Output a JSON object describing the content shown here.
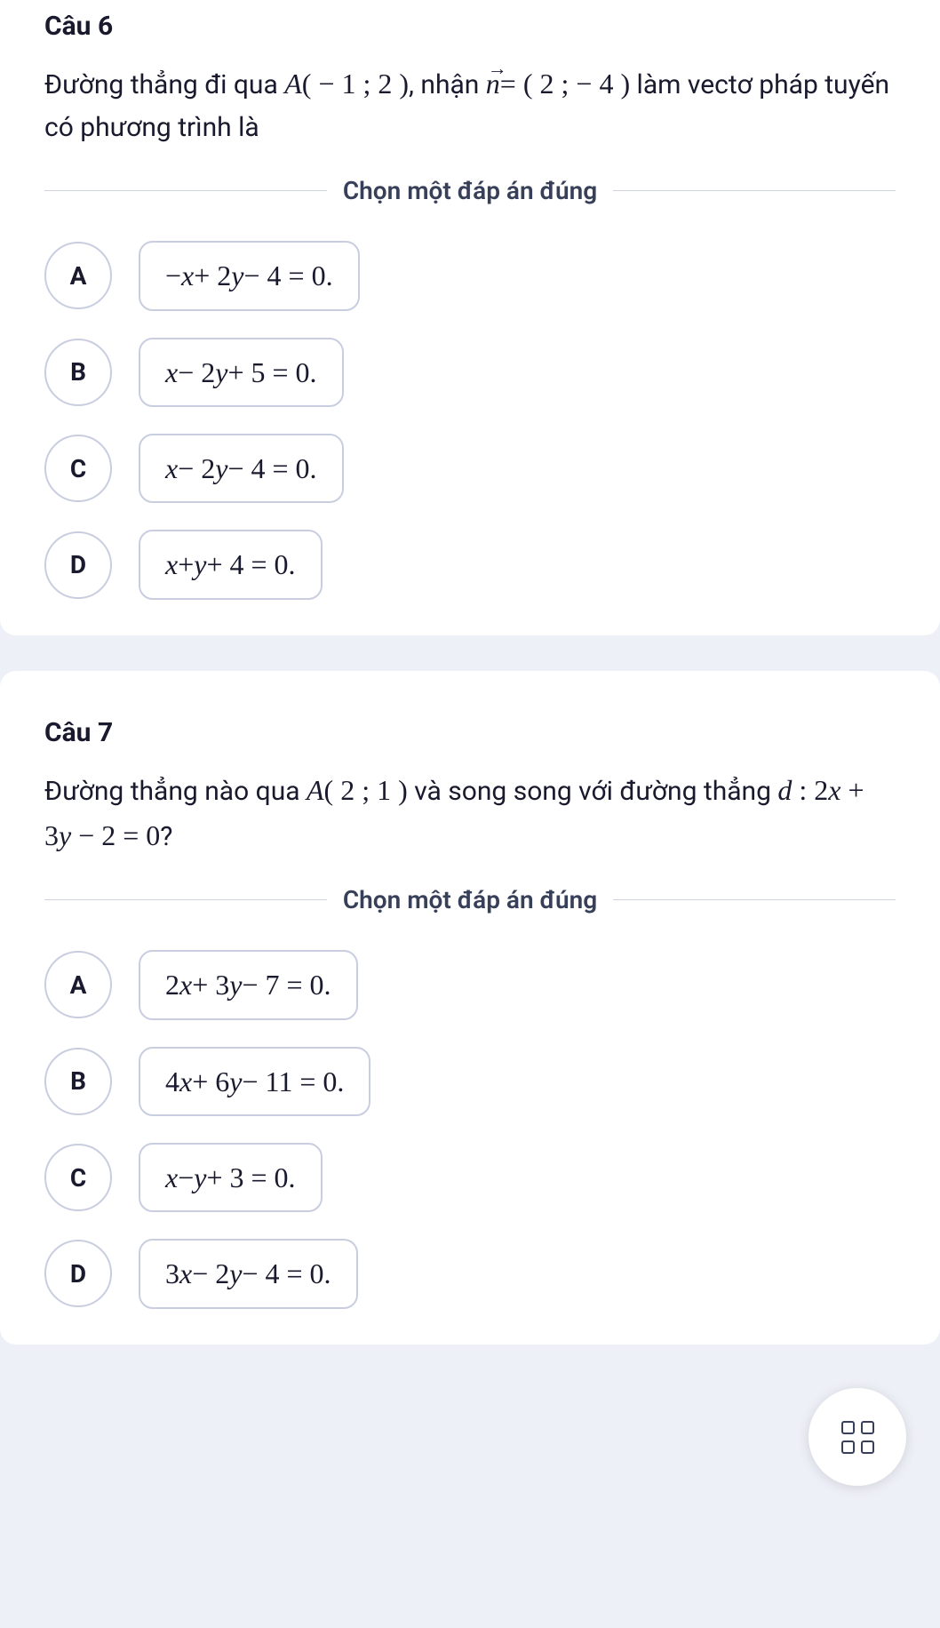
{
  "q6": {
    "title": "Câu 6",
    "text_part1": "Đường thẳng đi qua ",
    "math_A": "A",
    "math_Apt": "( − 1 ; 2 )",
    "text_part2": ", nhận ",
    "math_n": "n",
    "math_npt": "= ( 2 ; − 4 )",
    "text_part3": " làm vectơ pháp tuyến có phương trình là",
    "divider": "Chọn một đáp án đúng",
    "options": [
      {
        "letter": "A",
        "expr_html": "−<span class='mi'>x</span> + 2<span class='mi'>y</span> − 4 = 0."
      },
      {
        "letter": "B",
        "expr_html": "<span class='mi'>x</span> − 2<span class='mi'>y</span> + 5 = 0."
      },
      {
        "letter": "C",
        "expr_html": "<span class='mi'>x</span> − 2<span class='mi'>y</span> − 4 = 0."
      },
      {
        "letter": "D",
        "expr_html": "<span class='mi'>x</span> + <span class='mi'>y</span> + 4 = 0."
      }
    ]
  },
  "q7": {
    "title": "Câu 7",
    "text_part1": "Đường thẳng nào qua ",
    "math_A": "A",
    "math_Apt": "( 2 ; 1 )",
    "text_part2": " và song song với đường thẳng ",
    "math_d": "d",
    "math_deq": ": 2x + 3y − 2 = 0",
    "text_part3": "?",
    "divider": "Chọn một đáp án đúng",
    "options": [
      {
        "letter": "A",
        "expr_html": "2<span class='mi'>x</span> + 3<span class='mi'>y</span> − 7 = 0."
      },
      {
        "letter": "B",
        "expr_html": "4<span class='mi'>x</span> + 6<span class='mi'>y</span> − 11 = 0."
      },
      {
        "letter": "C",
        "expr_html": "<span class='mi'>x</span> − <span class='mi'>y</span> + 3 = 0."
      },
      {
        "letter": "D",
        "expr_html": "3<span class='mi'>x</span> − 2<span class='mi'>y</span> − 4 = 0."
      }
    ]
  },
  "fab_icon": "grid-icon"
}
